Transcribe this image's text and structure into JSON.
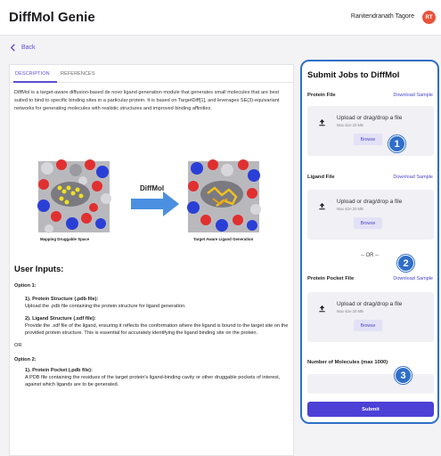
{
  "header": {
    "app_title": "DiffMol Genie",
    "user_name": "Ranitendranath Tagore",
    "avatar_initials": "RT"
  },
  "nav": {
    "back_label": "Back"
  },
  "tabs": [
    {
      "label": "DESCRIPTION",
      "active": true
    },
    {
      "label": "REFERENCES",
      "active": false
    }
  ],
  "description": "DiffMol is a target-aware diffusion-based de novo ligand generation module that generates small molecules that are best suited to bind to specific binding sites in a particular protein. It is based on TargetDiff[1], and leverages SE(3)-equivariant networks for generating molecules with realistic structures and improved binding affinities.",
  "figure": {
    "arrow_label": "DiffMol",
    "left_caption": "Mapping Druggable Space",
    "right_caption": "Target Aware Ligand Generation"
  },
  "user_inputs": {
    "title": "User Inputs:",
    "option1": "Option 1:",
    "o1_item1_title": "1). Protein Structure (.pdb file):",
    "o1_item1_text": "Upload the .pdb file containing the protein structure for ligand generation.",
    "o1_item2_title": "2). Ligand Structure (.sdf file):",
    "o1_item2_text": "Provide the .sdf file of the ligand, ensuring it reflects the conformation where the ligand is bound to the target site on the provided protein structure. This is essential for accurately identifying the ligand binding site on the protein.",
    "or": "OR",
    "option2": "Option 2:",
    "o2_item1_title": "1). Protein Pocket (.pdb file):",
    "o2_item1_text": "A PDB file containing the residues of the target protein's ligand-binding cavity or other druggable pockets of interest, against which ligands are to be generated."
  },
  "submit_panel": {
    "title": "Submit Jobs to DiffMol",
    "protein_file": {
      "label": "Protein File",
      "download": "Download Sample",
      "drop_text": "Upload or drag/drop a file",
      "max_size": "Max size 20 MB",
      "browse": "Browse"
    },
    "ligand_file": {
      "label": "Ligand File",
      "download": "Download Sample",
      "drop_text": "Upload or drag/drop a file",
      "max_size": "Max size 20 MB",
      "browse": "Browse"
    },
    "or_divider": "-- OR --",
    "pocket_file": {
      "label": "Protein Pocket File",
      "download": "Download Sample",
      "drop_text": "Upload or drag/drop a file",
      "max_size": "Max size 20 MB",
      "browse": "Browse"
    },
    "molecules_label": "Number of Molecules (max 1000)",
    "molecules_value": "",
    "submit_label": "Submit"
  },
  "badges": [
    "1",
    "2",
    "3"
  ],
  "colors": {
    "accent": "#5a4fd0",
    "badge_blue": "#2f6fc9",
    "submit": "#4c40d6",
    "avatar": "#e8533b"
  }
}
